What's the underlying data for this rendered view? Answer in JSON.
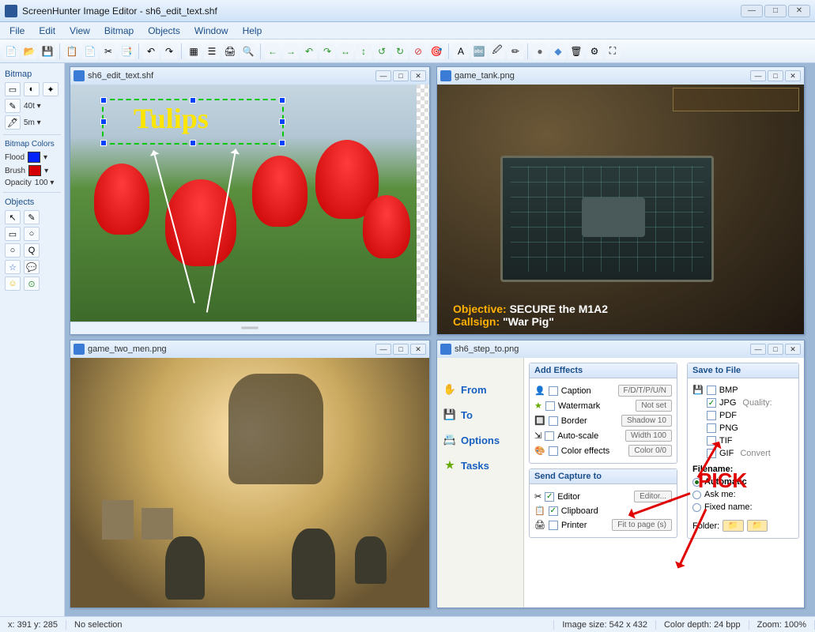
{
  "app": {
    "title": "ScreenHunter Image Editor - sh6_edit_text.shf"
  },
  "menu": {
    "items": [
      "File",
      "Edit",
      "View",
      "Bitmap",
      "Objects",
      "Window",
      "Help"
    ]
  },
  "toolbar": {
    "icons": [
      "📄",
      "📂",
      "💾",
      "",
      "📋",
      "📄",
      "✂",
      "📑",
      "",
      "↶",
      "↷",
      "",
      "🖨",
      "🔍",
      "",
      "⇐",
      "⇒",
      "",
      "↶",
      "↷",
      "↔",
      "↕",
      "↺",
      "↻",
      "⊘",
      "🎯",
      "",
      "A",
      "🔤",
      "🖉",
      "✏",
      "",
      "●",
      "◆",
      "🗑",
      "⚙",
      "⛶"
    ]
  },
  "sidebar": {
    "bitmap_hdr": "Bitmap",
    "bitmap_tools": [
      "▭",
      "◐",
      "✦"
    ],
    "row2": {
      "icon": "✎",
      "label": "40t ▾"
    },
    "row3": {
      "icon": "🖊",
      "label": "5m ▾"
    },
    "colors_hdr": "Bitmap Colors",
    "flood_label": "Flood",
    "flood_color": "#0022ff",
    "brush_label": "Brush",
    "brush_color": "#d40000",
    "opacity_label": "Opacity",
    "opacity_value": "100 ▾",
    "objects_hdr": "Objects",
    "obj_tools1": [
      "↖",
      "✎"
    ],
    "obj_tools2": [
      "▭",
      "○"
    ],
    "obj_tools3": [
      "○",
      "Q"
    ],
    "obj_tools4": [
      "☆",
      "💬"
    ],
    "obj_tools5": [
      "☺",
      "⊙"
    ]
  },
  "windows": {
    "w1": {
      "title": "sh6_edit_text.shf",
      "text_overlay": "Tulips"
    },
    "w2": {
      "title": "game_tank.png",
      "objective_label": "Objective:",
      "objective_value": "SECURE the M1A2",
      "callsign_label": "Callsign:",
      "callsign_value": "\"War Pig\""
    },
    "w3": {
      "title": "game_two_men.png"
    },
    "w4": {
      "title": "sh6_step_to.png",
      "nav": {
        "from": "From",
        "to": "To",
        "options": "Options",
        "tasks": "Tasks"
      },
      "effects": {
        "hdr": "Add Effects",
        "caption": "Caption",
        "caption_btn": "F/D/T/P/U/N",
        "watermark": "Watermark",
        "watermark_btn": "Not set",
        "border": "Border",
        "border_btn": "Shadow 10",
        "autoscale": "Auto-scale",
        "autoscale_btn": "Width 100",
        "coloreffects": "Color effects",
        "coloreffects_btn": "Color 0/0"
      },
      "send": {
        "hdr": "Send Capture to",
        "editor": "Editor",
        "editor_btn": "Editor...",
        "clipboard": "Clipboard",
        "printer": "Printer",
        "printer_btn": "Fit to page (s)"
      },
      "save": {
        "hdr": "Save to File",
        "bmp": "BMP",
        "jpg": "JPG",
        "jpg_extra": "Quality:",
        "pdf": "PDF",
        "png": "PNG",
        "tif": "TIF",
        "gif": "GIF",
        "gif_extra": "Convert",
        "filename_hdr": "Filename:",
        "automatic": "Automatic",
        "askme": "Ask me:",
        "fixed": "Fixed name:",
        "folder_label": "Folder:"
      },
      "pick": "PICK"
    }
  },
  "statusbar": {
    "coords": "x: 391 y: 285",
    "selection": "No selection",
    "size": "Image size: 542 x 432",
    "depth": "Color depth: 24 bpp",
    "zoom": "Zoom: 100%"
  }
}
